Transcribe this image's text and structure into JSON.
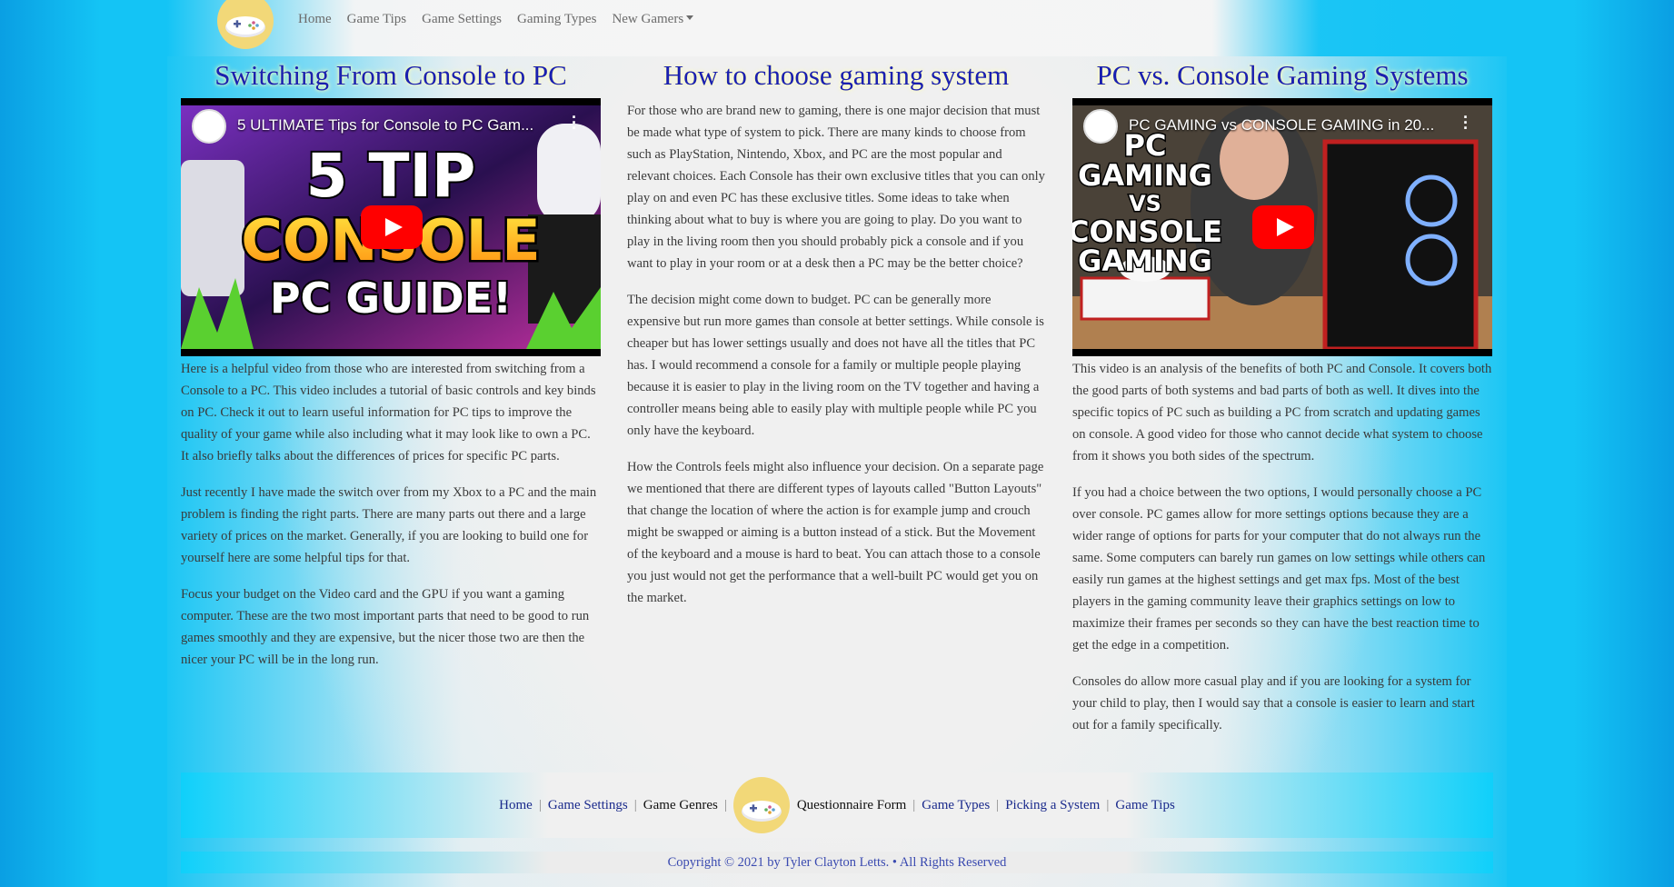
{
  "nav": {
    "logo_icon": "game-controller-icon",
    "links": [
      "Home",
      "Game Tips",
      "Game Settings",
      "Gaming Types",
      "New Gamers"
    ]
  },
  "columns": [
    {
      "title": "Switching From Console to PC",
      "video": {
        "title": "5 ULTIMATE Tips for Console to PC Gam...",
        "thumb_text": [
          "5 TIP",
          "CONSOLE",
          "PC GUIDE!"
        ]
      },
      "paragraphs": [
        "Here is a helpful video from those who are interested from switching from a Console to a PC. This video includes a tutorial of basic controls and key binds on PC. Check it out to learn useful information for PC tips to improve the quality of your game while also including what it may look like to own a PC. It also briefly talks about the differences of prices for specific PC parts.",
        "Just recently I have made the switch over from my Xbox to a PC and the main problem is finding the right parts. There are many parts out there and a large variety of prices on the market. Generally, if you are looking to build one for yourself here are some helpful tips for that.",
        "Focus your budget on the Video card and the GPU if you want a gaming computer. These are the two most important parts that need to be good to run games smoothly and they are expensive, but the nicer those two are then the nicer your PC will be in the long run."
      ]
    },
    {
      "title": "How to choose gaming system",
      "paragraphs": [
        "For those who are brand new to gaming, there is one major decision that must be made what type of system to pick. There are many kinds to choose from such as PlayStation, Nintendo, Xbox, and PC are the most popular and relevant choices. Each Console has their own exclusive titles that you can only play on and even PC has these exclusive titles. Some ideas to take when thinking about what to buy is where you are going to play. Do you want to play in the living room then you should probably pick a console and if you want to play in your room or at a desk then a PC may be the better choice?",
        "The decision might come down to budget. PC can be generally more expensive but run more games than console at better settings. While console is cheaper but has lower settings usually and does not have all the titles that PC has. I would recommend a console for a family or multiple people playing because it is easier to play in the living room on the TV together and having a controller means being able to easily play with multiple people while PC you only have the keyboard.",
        "How the Controls feels might also influence your decision. On a separate page we mentioned that there are different types of layouts called \"Button Layouts\" that change the location of where the action is for example jump and crouch might be swapped or aiming is a button instead of a stick. But the Movement of the keyboard and a mouse is hard to beat. You can attach those to a console you just would not get the performance that a well-built PC would get you on the market."
      ]
    },
    {
      "title": "PC vs. Console Gaming Systems",
      "video": {
        "title": "PC GAMING vs CONSOLE GAMING in 20...",
        "thumb_text": [
          "PC",
          "GAMING",
          "VS",
          "CONSOLE",
          "GAMING"
        ]
      },
      "paragraphs": [
        "This video is an analysis of the benefits of both PC and Console. It covers both the good parts of both systems and bad parts of both as well. It dives into the specific topics of PC such as building a PC from scratch and updating games on console. A good video for those who cannot decide what system to choose from it shows you both sides of the spectrum.",
        "If you had a choice between the two options, I would personally choose a PC over console. PC games allow for more settings options because they are a wider range of options for parts for your computer that do not always run the same. Some computers can barely run games on low settings while others can easily run games at the highest settings and get max fps. Most of the best players in the gaming community leave their graphics settings on low to maximize their frames per seconds so they can have the best reaction time to get the edge in a competition.",
        "Consoles do allow more casual play and if you are looking for a system for your child to play, then I would say that a console is easier to learn and start out for a family specifically."
      ]
    }
  ],
  "footer": {
    "links": [
      "Home",
      "Game Settings",
      "Game Genres",
      "Questionnaire Form",
      "Game Types",
      "Picking a System",
      "Game Tips"
    ],
    "separator": "|",
    "copyright": "Copyright © 2021 by Tyler Clayton Letts. • All Rights Reserved"
  },
  "colors": {
    "heading": "#1a20b0",
    "heading_glow": "#ffffb8",
    "background": "#14c4f5",
    "logo": "#f2d878",
    "youtube_play": "#ff0000"
  }
}
